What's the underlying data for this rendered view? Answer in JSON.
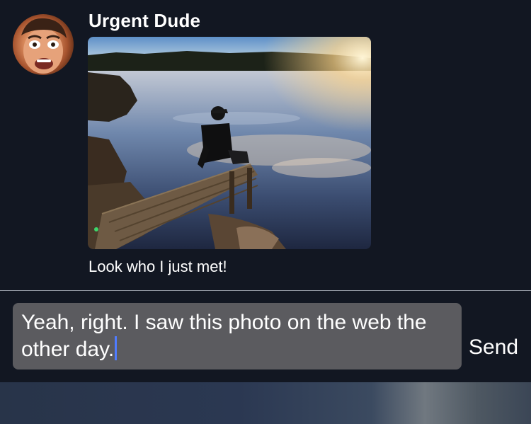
{
  "message": {
    "sender_name": "Urgent Dude",
    "caption": "Look who I just met!"
  },
  "composer": {
    "input_value": "Yeah, right. I saw this photo on the web the other day.",
    "send_label": "Send"
  },
  "icons": {
    "avatar": "avatar",
    "photo": "photo-attachment"
  }
}
